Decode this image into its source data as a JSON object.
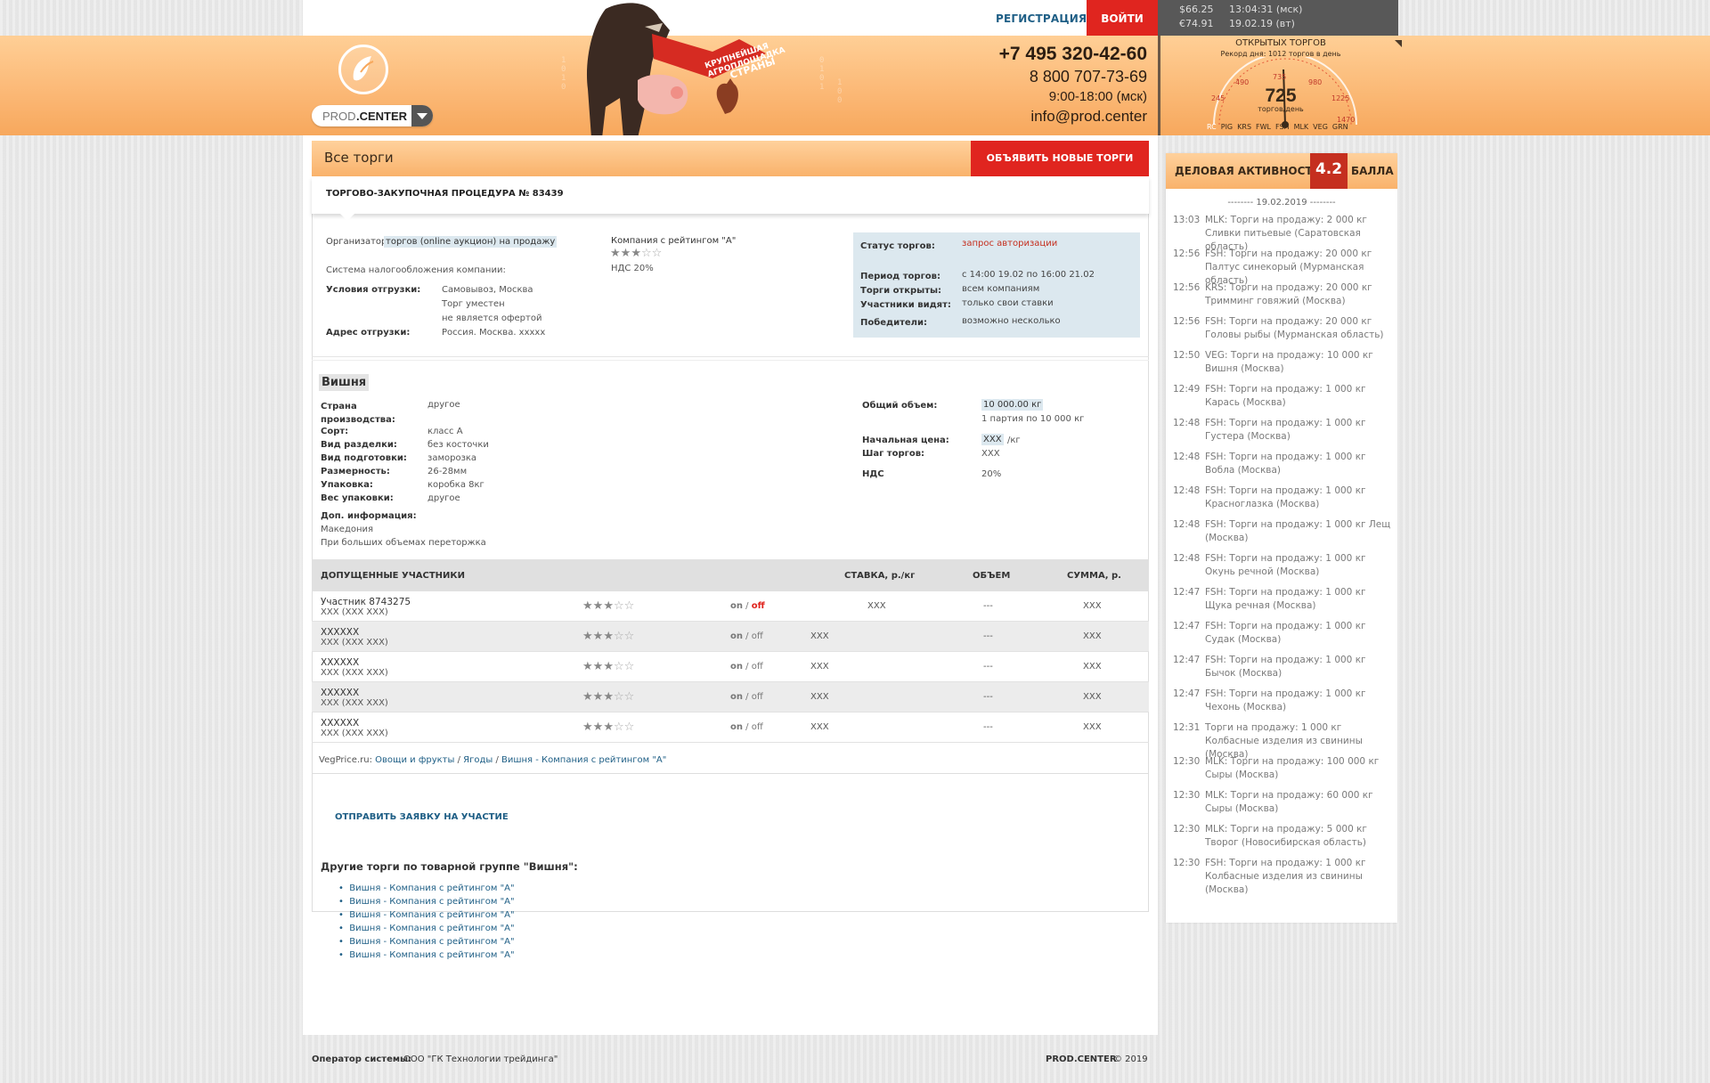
{
  "topbar": {
    "register": "РЕГИСТРАЦИЯ",
    "login": "ВОЙТИ"
  },
  "rates": {
    "usd": "$66.25",
    "usd_time": "13:04:31 (мск)",
    "eur": "€74.91",
    "eur_date": "19.02.19 (вт)"
  },
  "logo": {
    "text_a": "PROD",
    "text_b": ".CENTER"
  },
  "banner": {
    "ribbon_top": "крупнейшая агроплощадка",
    "ribbon_bottom": "страны"
  },
  "contacts": {
    "phone1": "+7 495 320-42-60",
    "phone2": "8 800 707-73-69",
    "hours": "9:00-18:00 (мск)",
    "email": "info@prod.center"
  },
  "gauge": {
    "title": "ОТКРЫТЫХ ТОРГОВ",
    "record": "Рекорд дня: 1012 торгов в день",
    "value": "725",
    "unit": "торгов/день",
    "ticks": [
      "245",
      "490",
      "735",
      "980",
      "1225",
      "1470"
    ],
    "categories": [
      "RC",
      "PIG",
      "KRS",
      "FWL",
      "FSH",
      "MLK",
      "VEG",
      "GRN"
    ],
    "level": 0.49
  },
  "page": {
    "section_title": "Все торги",
    "new_button": "ОБЪЯВИТЬ НОВЫЕ ТОРГИ",
    "procedure": "ТОРГОВО-ЗАКУПОЧНАЯ ПРОЦЕДУРА № 83439"
  },
  "info": {
    "organizer_label": "Организатор",
    "organizer_value": "торгов (online аукцион) на продажу",
    "tax_label": "Система налогообложения компании:",
    "company": "Компания с рейтингом \"А\"",
    "company_rating": 3,
    "vat": "НДС 20%",
    "ship_label": "Условия отгрузки:",
    "ship_values": [
      "Самовывоз, Москва",
      "Торг уместен",
      "не является офертой"
    ],
    "addr_label": "Адрес отгрузки:",
    "addr_value": "Россия. Москва. xxxxx",
    "status_label": "Статус торгов:",
    "status_value": "запрос авторизации",
    "period_label": "Период торгов:",
    "period_value": "с 14:00 19.02 по 16:00 21.02",
    "open_label": "Торги открыты:",
    "open_value": "всем компаниям",
    "see_label": "Участники видят:",
    "see_value": "только свои ставки",
    "win_label": "Победители:",
    "win_value": "возможно несколько"
  },
  "product": {
    "name": "Вишня",
    "props": [
      {
        "k": "Страна производства:",
        "v": "другое"
      },
      {
        "k": "Сорт:",
        "v": "класс А"
      },
      {
        "k": "Вид разделки:",
        "v": "без косточки"
      },
      {
        "k": "Вид подготовки:",
        "v": "заморозка"
      },
      {
        "k": "Размерность:",
        "v": "26-28мм"
      },
      {
        "k": "Упаковка:",
        "v": "коробка 8кг"
      },
      {
        "k": "Вес упаковки:",
        "v": "другое"
      }
    ],
    "extra_label": "Доп. информация:",
    "extra_lines": [
      "Македония",
      "При больших объемах переторжка"
    ],
    "volume_label": "Общий объем:",
    "volume_value": "10 000.00 кг",
    "volume_note": "1 партия по 10 000 кг",
    "price_label": "Начальная цена:",
    "price_value": "XXX",
    "price_unit": "/кг",
    "step_label": "Шаг торгов:",
    "step_value": "XXX",
    "vat_label": "НДС",
    "vat_value": "20%"
  },
  "table": {
    "headers": [
      "ДОПУЩЕННЫЕ УЧАСТНИКИ",
      "СТАВКА, р./кг",
      "ОБЪЕМ",
      "СУММА, р."
    ],
    "rows": [
      {
        "name": "Участник 8743275",
        "sub": "XXX (XXX XXX)",
        "rating": 3,
        "on": "on",
        "sep": " / ",
        "off": "off",
        "bid": "XXX",
        "vol": "---",
        "sum": "XXX"
      },
      {
        "name": "XXXXXX",
        "sub": "XXX (XXX XXX)",
        "rating": 3,
        "on": "on",
        "sep": " / ",
        "off": "off",
        "bid": "XXX",
        "vol": "---",
        "sum": "XXX"
      },
      {
        "name": "XXXXXX",
        "sub": "XXX (XXX XXX)",
        "rating": 3,
        "on": "on",
        "sep": " / ",
        "off": "off",
        "bid": "XXX",
        "vol": "---",
        "sum": "XXX"
      },
      {
        "name": "XXXXXX",
        "sub": "XXX (XXX XXX)",
        "rating": 3,
        "on": "on",
        "sep": " / ",
        "off": "off",
        "bid": "XXX",
        "vol": "---",
        "sum": "XXX"
      },
      {
        "name": "XXXXXX",
        "sub": "XXX (XXX XXX)",
        "rating": 3,
        "on": "on",
        "sep": " / ",
        "off": "off",
        "bid": "XXX",
        "vol": "---",
        "sum": "XXX"
      }
    ]
  },
  "breadcrumb": {
    "site": "VegPrice.ru:",
    "b1": "Овощи и фрукты",
    "b2": "Ягоды",
    "b3": "Вишня - Компания с рейтингом \"А\"",
    "sep": " / "
  },
  "apply": "ОТПРАВИТЬ ЗАЯВКУ НА УЧАСТИЕ",
  "other": {
    "title": "Другие торги по товарной группе \"Вишня\":",
    "items": [
      "Вишня - Компания с рейтингом \"А\"",
      "Вишня - Компания с рейтингом \"А\"",
      "Вишня - Компания с рейтингом \"А\"",
      "Вишня - Компания с рейтингом \"А\"",
      "Вишня - Компания с рейтингом \"А\"",
      "Вишня - Компания с рейтингом \"А\""
    ]
  },
  "activity": {
    "label": "ДЕЛОВАЯ АКТИВНОСТЬ",
    "score": "4.2",
    "unit": "БАЛЛА",
    "date": "-------- 19.02.2019 --------"
  },
  "feed": [
    {
      "t": "13:03",
      "x": "MLK: Торги на продажу: 2 000 кг Сливки питьевые (Саратовская область)"
    },
    {
      "t": "12:56",
      "x": "FSH: Торги на продажу: 20 000 кг Палтус синекорый (Мурманская область)"
    },
    {
      "t": "12:56",
      "x": "KRS: Торги на продажу: 20 000 кг Тримминг говяжий (Москва)"
    },
    {
      "t": "12:56",
      "x": "FSH: Торги на продажу: 20 000 кг Головы рыбы (Мурманская область)"
    },
    {
      "t": "12:50",
      "x": "VEG: Торги на продажу: 10 000 кг Вишня (Москва)"
    },
    {
      "t": "12:49",
      "x": "FSH: Торги на продажу: 1 000 кг Карась (Москва)"
    },
    {
      "t": "12:48",
      "x": "FSH: Торги на продажу: 1 000 кг Густера (Москва)"
    },
    {
      "t": "12:48",
      "x": "FSH: Торги на продажу: 1 000 кг Вобла (Москва)"
    },
    {
      "t": "12:48",
      "x": "FSH: Торги на продажу: 1 000 кг Красноглазка (Москва)"
    },
    {
      "t": "12:48",
      "x": "FSH: Торги на продажу: 1 000 кг Лещ (Москва)"
    },
    {
      "t": "12:48",
      "x": "FSH: Торги на продажу: 1 000 кг Окунь речной (Москва)"
    },
    {
      "t": "12:47",
      "x": "FSH: Торги на продажу: 1 000 кг Щука речная (Москва)"
    },
    {
      "t": "12:47",
      "x": "FSH: Торги на продажу: 1 000 кг Судак (Москва)"
    },
    {
      "t": "12:47",
      "x": "FSH: Торги на продажу: 1 000 кг Бычок (Москва)"
    },
    {
      "t": "12:47",
      "x": "FSH: Торги на продажу: 1 000 кг Чехонь (Москва)"
    },
    {
      "t": "12:31",
      "x": "Торги на продажу: 1 000 кг Колбасные изделия из свинины (Москва)"
    },
    {
      "t": "12:30",
      "x": "MLK: Торги на продажу: 100 000 кг Сыры (Москва)"
    },
    {
      "t": "12:30",
      "x": "MLK: Торги на продажу: 60 000 кг Сыры (Москва)"
    },
    {
      "t": "12:30",
      "x": "MLK: Торги на продажу: 5 000 кг Творог (Новосибирская область)"
    },
    {
      "t": "12:30",
      "x": "FSH: Торги на продажу: 1 000 кг Колбасные изделия из свинины (Москва)"
    }
  ],
  "footer": {
    "operator_label": "Оператор системы:",
    "operator_value": "ООО \"ГК Технологии трейдинга\"",
    "brand": "PROD.CENTER",
    "copy": "© 2019"
  },
  "colors": {
    "accent": "#e0251f",
    "orange": "#f9b26b",
    "link": "#1f5f86",
    "dark_red": "#c52f1f"
  }
}
